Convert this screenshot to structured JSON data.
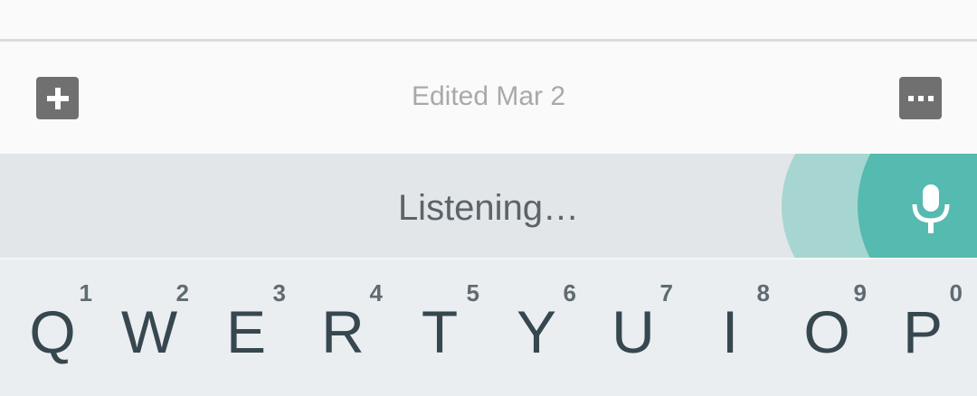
{
  "toolbar": {
    "edited_label": "Edited Mar 2",
    "add_icon": "plus-icon",
    "more_icon": "more-horizontal-icon",
    "icon_button_color": "#707070"
  },
  "voice": {
    "status": "Listening…",
    "mic_icon": "microphone-icon",
    "accent": "#55bab0",
    "ripple_color": "#a7d5d2"
  },
  "keyboard": {
    "keys": [
      {
        "letter": "Q",
        "hint": "1"
      },
      {
        "letter": "W",
        "hint": "2"
      },
      {
        "letter": "E",
        "hint": "3"
      },
      {
        "letter": "R",
        "hint": "4"
      },
      {
        "letter": "T",
        "hint": "5"
      },
      {
        "letter": "Y",
        "hint": "6"
      },
      {
        "letter": "U",
        "hint": "7"
      },
      {
        "letter": "I",
        "hint": "8"
      },
      {
        "letter": "O",
        "hint": "9"
      },
      {
        "letter": "P",
        "hint": "0"
      }
    ]
  }
}
